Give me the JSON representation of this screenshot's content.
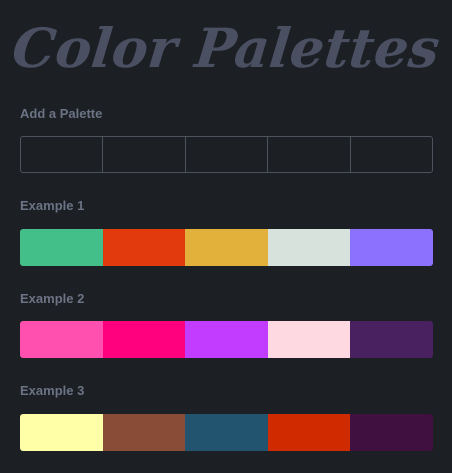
{
  "header": {
    "title": "Color Palettes"
  },
  "add_palette": {
    "label": "Add a Palette",
    "slot_count": 5
  },
  "examples": [
    {
      "label": "Example 1",
      "colors": [
        "#43bf8a",
        "#e33a0d",
        "#e2b13c",
        "#d8e2dd",
        "#8c71ff"
      ]
    },
    {
      "label": "Example 2",
      "colors": [
        "#ff4faf",
        "#ff007f",
        "#c13cff",
        "#ffd9e2",
        "#4a2160"
      ]
    },
    {
      "label": "Example 3",
      "colors": [
        "#ffffa8",
        "#894c36",
        "#22536f",
        "#cf2a00",
        "#3f1040"
      ]
    }
  ]
}
